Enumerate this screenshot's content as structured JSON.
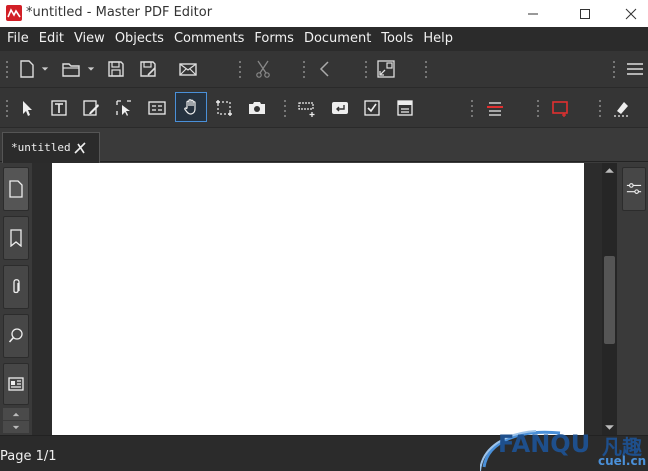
{
  "window": {
    "title": "*untitled - Master PDF Editor"
  },
  "menu": [
    "File",
    "Edit",
    "View",
    "Objects",
    "Comments",
    "Forms",
    "Document",
    "Tools",
    "Help"
  ],
  "search": {
    "value": ""
  },
  "tabs": [
    {
      "label": "*untitled",
      "active": true
    }
  ],
  "status": {
    "page": "Page 1/1"
  },
  "watermark": {
    "brand": "FANQU",
    "brand_cn": "凡趣",
    "domain": "cuel.cn"
  },
  "colors": {
    "accent": "#4a90d9",
    "red_tool": "#e03030",
    "logo_red": "#d21f26"
  }
}
